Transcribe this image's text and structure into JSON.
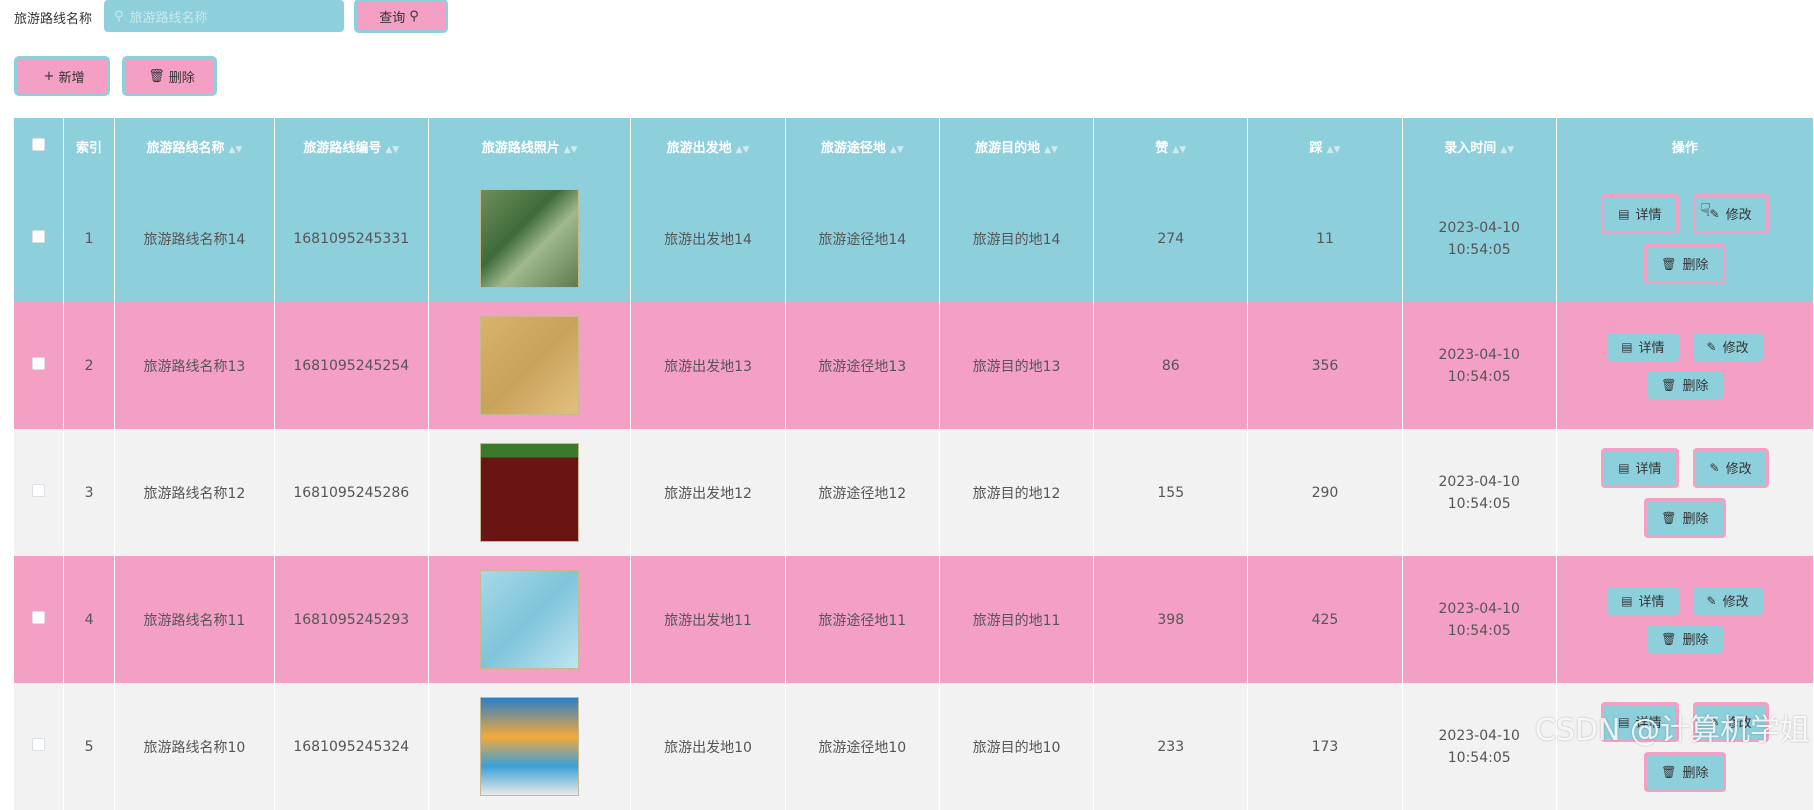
{
  "search": {
    "label": "旅游路线名称",
    "placeholder": "旅游路线名称",
    "query_label": "查询"
  },
  "toolbar": {
    "add_label": "新增",
    "delete_label": "删除"
  },
  "table": {
    "columns": [
      "索引",
      "旅游路线名称",
      "旅游路线编号",
      "旅游路线照片",
      "旅游出发地",
      "旅游途径地",
      "旅游目的地",
      "赞",
      "踩",
      "录入时间",
      "操作"
    ],
    "rows": [
      {
        "index": "1",
        "name": "旅游路线名称14",
        "code": "1681095245331",
        "from": "旅游出发地14",
        "via": "旅游途径地14",
        "dest": "旅游目的地14",
        "likes": "274",
        "dislikes": "11",
        "time": "2023-04-10 10:54:05"
      },
      {
        "index": "2",
        "name": "旅游路线名称13",
        "code": "1681095245254",
        "from": "旅游出发地13",
        "via": "旅游途径地13",
        "dest": "旅游目的地13",
        "likes": "86",
        "dislikes": "356",
        "time": "2023-04-10 10:54:05"
      },
      {
        "index": "3",
        "name": "旅游路线名称12",
        "code": "1681095245286",
        "from": "旅游出发地12",
        "via": "旅游途径地12",
        "dest": "旅游目的地12",
        "likes": "155",
        "dislikes": "290",
        "time": "2023-04-10 10:54:05"
      },
      {
        "index": "4",
        "name": "旅游路线名称11",
        "code": "1681095245293",
        "from": "旅游出发地11",
        "via": "旅游途径地11",
        "dest": "旅游目的地11",
        "likes": "398",
        "dislikes": "425",
        "time": "2023-04-10 10:54:05"
      },
      {
        "index": "5",
        "name": "旅游路线名称10",
        "code": "1681095245324",
        "from": "旅游出发地10",
        "via": "旅游途径地10",
        "dest": "旅游目的地10",
        "likes": "233",
        "dislikes": "173",
        "time": "2023-04-10 10:54:05"
      }
    ],
    "ops": {
      "detail": "详情",
      "edit": "修改",
      "delete": "删除"
    }
  },
  "watermark": "CSDN @计算机学姐",
  "colors": {
    "accent_blue": "#8ecfdc",
    "accent_pink": "#f4a0c4",
    "row_gray": "#f2f2f2"
  }
}
